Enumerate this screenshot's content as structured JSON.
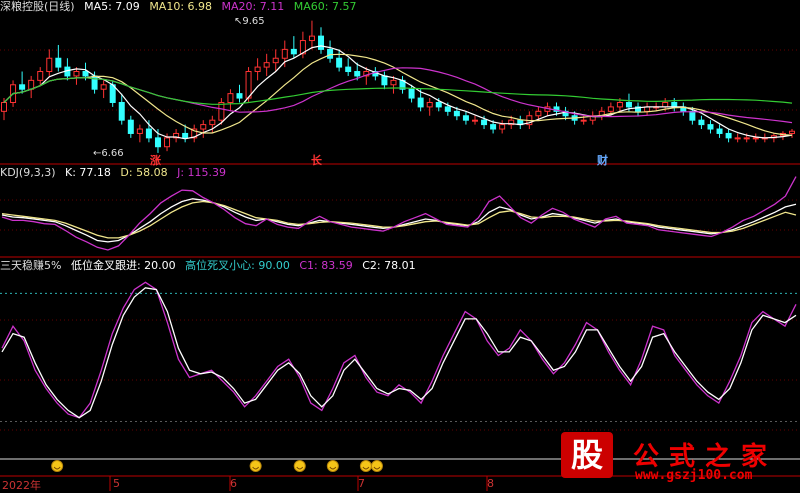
{
  "header_main": {
    "name": "深粮控股(日线)",
    "items": [
      {
        "label": "MA5: 7.09",
        "color": "#ffffff"
      },
      {
        "label": "MA10: 6.98",
        "color": "#f0e68c"
      },
      {
        "label": "MA20: 7.11",
        "color": "#cc33cc"
      },
      {
        "label": "MA60: 7.57",
        "color": "#33cc33"
      }
    ]
  },
  "header_kdj": {
    "name": "KDJ(9,3,3)",
    "items": [
      {
        "label": "K: 77.18",
        "color": "#ffffff"
      },
      {
        "label": "D: 58.08",
        "color": "#f0e68c"
      },
      {
        "label": "J: 115.39",
        "color": "#cc33cc"
      }
    ]
  },
  "header_ind": {
    "name": "三天稳赚5%",
    "items": [
      {
        "label": "低位金叉跟进: 20.00",
        "color": "#ffffff"
      },
      {
        "label": "高位死叉小心: 90.00",
        "color": "#33cccc"
      },
      {
        "label": "C1: 83.59",
        "color": "#cc33cc"
      },
      {
        "label": "C2: 78.01",
        "color": "#ffffff"
      }
    ]
  },
  "annotations": {
    "high": "9.65",
    "low": "6.66"
  },
  "event_markers": [
    "涨",
    "长",
    "财"
  ],
  "x_labels": [
    "2022年",
    "5",
    "6",
    "7",
    "8"
  ],
  "watermark": {
    "logo": "股",
    "title": "公式之家",
    "url": "www.gszj100.com"
  },
  "chart_data": [
    {
      "type": "candlestick",
      "title": "深粮控股(日线)",
      "y_range": [
        6.5,
        9.8
      ],
      "ohlc": [
        [
          7.6,
          7.9,
          7.4,
          7.8
        ],
        [
          7.8,
          8.3,
          7.7,
          8.2
        ],
        [
          8.2,
          8.5,
          8.0,
          8.1
        ],
        [
          8.1,
          8.4,
          7.9,
          8.3
        ],
        [
          8.3,
          8.6,
          8.2,
          8.5
        ],
        [
          8.5,
          9.0,
          8.4,
          8.8
        ],
        [
          8.8,
          9.1,
          8.5,
          8.6
        ],
        [
          8.6,
          8.8,
          8.3,
          8.4
        ],
        [
          8.4,
          8.6,
          8.2,
          8.5
        ],
        [
          8.5,
          8.7,
          8.3,
          8.4
        ],
        [
          8.4,
          8.5,
          8.0,
          8.1
        ],
        [
          8.1,
          8.3,
          7.9,
          8.2
        ],
        [
          8.2,
          8.3,
          7.7,
          7.8
        ],
        [
          7.8,
          8.0,
          7.3,
          7.4
        ],
        [
          7.4,
          7.5,
          7.0,
          7.1
        ],
        [
          7.1,
          7.3,
          6.9,
          7.2
        ],
        [
          7.2,
          7.4,
          6.9,
          7.0
        ],
        [
          7.0,
          7.2,
          6.66,
          6.8
        ],
        [
          6.8,
          7.1,
          6.7,
          7.0
        ],
        [
          7.0,
          7.2,
          6.9,
          7.1
        ],
        [
          7.1,
          7.3,
          6.9,
          7.0
        ],
        [
          7.0,
          7.3,
          6.9,
          7.2
        ],
        [
          7.2,
          7.4,
          7.0,
          7.3
        ],
        [
          7.3,
          7.5,
          7.1,
          7.4
        ],
        [
          7.4,
          7.9,
          7.3,
          7.8
        ],
        [
          7.8,
          8.1,
          7.6,
          8.0
        ],
        [
          8.0,
          8.2,
          7.8,
          7.9
        ],
        [
          7.9,
          8.6,
          7.8,
          8.5
        ],
        [
          8.5,
          8.8,
          8.3,
          8.6
        ],
        [
          8.6,
          8.9,
          8.4,
          8.7
        ],
        [
          8.7,
          9.0,
          8.5,
          8.8
        ],
        [
          8.8,
          9.2,
          8.6,
          9.0
        ],
        [
          9.0,
          9.3,
          8.8,
          8.9
        ],
        [
          8.9,
          9.4,
          8.8,
          9.2
        ],
        [
          9.2,
          9.65,
          9.0,
          9.3
        ],
        [
          9.3,
          9.5,
          8.9,
          9.0
        ],
        [
          9.0,
          9.2,
          8.7,
          8.8
        ],
        [
          8.8,
          9.0,
          8.5,
          8.6
        ],
        [
          8.6,
          8.8,
          8.4,
          8.5
        ],
        [
          8.5,
          8.7,
          8.3,
          8.4
        ],
        [
          8.4,
          8.6,
          8.2,
          8.5
        ],
        [
          8.5,
          8.6,
          8.3,
          8.4
        ],
        [
          8.4,
          8.5,
          8.1,
          8.2
        ],
        [
          8.2,
          8.4,
          8.0,
          8.3
        ],
        [
          8.3,
          8.4,
          8.0,
          8.1
        ],
        [
          8.1,
          8.2,
          7.8,
          7.9
        ],
        [
          7.9,
          8.1,
          7.6,
          7.7
        ],
        [
          7.7,
          7.9,
          7.5,
          7.8
        ],
        [
          7.8,
          7.9,
          7.6,
          7.7
        ],
        [
          7.7,
          7.8,
          7.5,
          7.6
        ],
        [
          7.6,
          7.7,
          7.4,
          7.5
        ],
        [
          7.5,
          7.6,
          7.3,
          7.4
        ],
        [
          7.4,
          7.5,
          7.3,
          7.4
        ],
        [
          7.4,
          7.5,
          7.2,
          7.3
        ],
        [
          7.3,
          7.4,
          7.1,
          7.2
        ],
        [
          7.2,
          7.4,
          7.1,
          7.3
        ],
        [
          7.3,
          7.5,
          7.2,
          7.4
        ],
        [
          7.4,
          7.5,
          7.2,
          7.3
        ],
        [
          7.3,
          7.6,
          7.2,
          7.5
        ],
        [
          7.5,
          7.7,
          7.4,
          7.6
        ],
        [
          7.6,
          7.8,
          7.5,
          7.7
        ],
        [
          7.7,
          7.8,
          7.5,
          7.6
        ],
        [
          7.6,
          7.7,
          7.4,
          7.5
        ],
        [
          7.5,
          7.6,
          7.3,
          7.4
        ],
        [
          7.4,
          7.5,
          7.3,
          7.4
        ],
        [
          7.4,
          7.6,
          7.3,
          7.5
        ],
        [
          7.5,
          7.7,
          7.4,
          7.6
        ],
        [
          7.6,
          7.8,
          7.5,
          7.7
        ],
        [
          7.7,
          7.9,
          7.6,
          7.8
        ],
        [
          7.8,
          8.0,
          7.6,
          7.7
        ],
        [
          7.7,
          7.8,
          7.5,
          7.6
        ],
        [
          7.6,
          7.8,
          7.5,
          7.7
        ],
        [
          7.7,
          7.8,
          7.6,
          7.7
        ],
        [
          7.7,
          7.9,
          7.6,
          7.8
        ],
        [
          7.8,
          7.9,
          7.6,
          7.7
        ],
        [
          7.7,
          7.8,
          7.5,
          7.6
        ],
        [
          7.6,
          7.7,
          7.3,
          7.4
        ],
        [
          7.4,
          7.5,
          7.2,
          7.3
        ],
        [
          7.3,
          7.4,
          7.1,
          7.2
        ],
        [
          7.2,
          7.3,
          7.0,
          7.1
        ],
        [
          7.1,
          7.2,
          6.9,
          7.0
        ],
        [
          7.0,
          7.1,
          6.9,
          7.0
        ],
        [
          7.0,
          7.1,
          6.9,
          7.0
        ],
        [
          7.0,
          7.1,
          6.9,
          7.0
        ],
        [
          7.0,
          7.1,
          6.9,
          7.0
        ],
        [
          7.0,
          7.1,
          6.9,
          7.05
        ],
        [
          7.05,
          7.15,
          6.95,
          7.1
        ],
        [
          7.1,
          7.2,
          7.0,
          7.15
        ]
      ]
    },
    {
      "type": "line",
      "title": "KDJ(9,3,3)",
      "y_range": [
        0,
        110
      ],
      "series": [
        {
          "name": "K",
          "color": "#ffffff",
          "values": [
            58,
            55,
            54,
            52,
            50,
            48,
            42,
            35,
            28,
            20,
            18,
            20,
            28,
            38,
            48,
            60,
            70,
            78,
            82,
            80,
            76,
            70,
            62,
            55,
            50,
            52,
            48,
            44,
            42,
            46,
            50,
            48,
            46,
            44,
            42,
            40,
            38,
            40,
            44,
            48,
            52,
            50,
            46,
            44,
            42,
            48,
            62,
            70,
            66,
            58,
            52,
            55,
            60,
            58,
            54,
            50,
            46,
            50,
            52,
            48,
            46,
            44,
            40,
            38,
            36,
            34,
            32,
            30,
            32,
            36,
            42,
            48,
            55,
            62,
            70,
            74
          ]
        },
        {
          "name": "D",
          "color": "#f0e68c",
          "values": [
            60,
            58,
            56,
            54,
            52,
            50,
            46,
            40,
            34,
            28,
            24,
            24,
            28,
            34,
            42,
            52,
            62,
            70,
            76,
            78,
            76,
            72,
            66,
            60,
            54,
            52,
            50,
            46,
            44,
            45,
            47,
            48,
            47,
            46,
            44,
            42,
            40,
            40,
            42,
            45,
            48,
            49,
            47,
            45,
            43,
            45,
            54,
            62,
            64,
            60,
            55,
            54,
            56,
            56,
            55,
            52,
            49,
            49,
            50,
            49,
            47,
            45,
            42,
            40,
            38,
            36,
            34,
            32,
            32,
            34,
            38,
            44,
            50,
            56,
            62,
            58
          ]
        },
        {
          "name": "J",
          "color": "#cc33cc",
          "values": [
            55,
            50,
            50,
            48,
            45,
            44,
            35,
            25,
            18,
            10,
            6,
            12,
            28,
            46,
            60,
            76,
            86,
            95,
            94,
            84,
            76,
            66,
            54,
            45,
            42,
            52,
            44,
            40,
            38,
            48,
            56,
            48,
            44,
            40,
            38,
            36,
            34,
            40,
            48,
            54,
            60,
            52,
            44,
            42,
            40,
            54,
            78,
            86,
            70,
            54,
            46,
            58,
            68,
            62,
            52,
            46,
            40,
            52,
            56,
            46,
            44,
            42,
            36,
            34,
            32,
            30,
            28,
            26,
            32,
            40,
            50,
            56,
            65,
            74,
            86,
            115
          ]
        }
      ]
    },
    {
      "type": "line",
      "title": "三天稳赚5%",
      "y_range": [
        0,
        100
      ],
      "reference_lines": [
        {
          "name": "低位金叉跟进",
          "value": 20
        },
        {
          "name": "高位死叉小心",
          "value": 90
        }
      ],
      "series": [
        {
          "name": "C1",
          "color": "#cc33cc",
          "values": [
            60,
            72,
            64,
            48,
            38,
            30,
            24,
            22,
            30,
            48,
            68,
            82,
            92,
            96,
            92,
            74,
            54,
            44,
            46,
            48,
            42,
            36,
            28,
            34,
            42,
            50,
            54,
            44,
            30,
            26,
            38,
            52,
            56,
            44,
            36,
            34,
            40,
            36,
            30,
            42,
            56,
            68,
            80,
            76,
            64,
            56,
            60,
            70,
            64,
            54,
            46,
            52,
            62,
            74,
            70,
            58,
            48,
            40,
            54,
            72,
            70,
            56,
            48,
            40,
            34,
            30,
            42,
            56,
            74,
            80,
            76,
            72,
            84
          ]
        },
        {
          "name": "C2",
          "color": "#ffffff",
          "values": [
            58,
            68,
            66,
            52,
            40,
            32,
            26,
            22,
            26,
            42,
            62,
            78,
            88,
            93,
            92,
            80,
            60,
            48,
            46,
            47,
            44,
            38,
            30,
            32,
            40,
            48,
            52,
            46,
            34,
            28,
            34,
            48,
            54,
            46,
            38,
            35,
            38,
            37,
            32,
            38,
            52,
            64,
            76,
            76,
            68,
            58,
            58,
            66,
            64,
            56,
            48,
            50,
            58,
            70,
            70,
            60,
            50,
            42,
            50,
            66,
            68,
            58,
            50,
            42,
            36,
            32,
            38,
            52,
            70,
            78,
            76,
            74,
            78
          ]
        }
      ],
      "signal_days": [
        5,
        23,
        27,
        30,
        33,
        34,
        54
      ]
    }
  ]
}
